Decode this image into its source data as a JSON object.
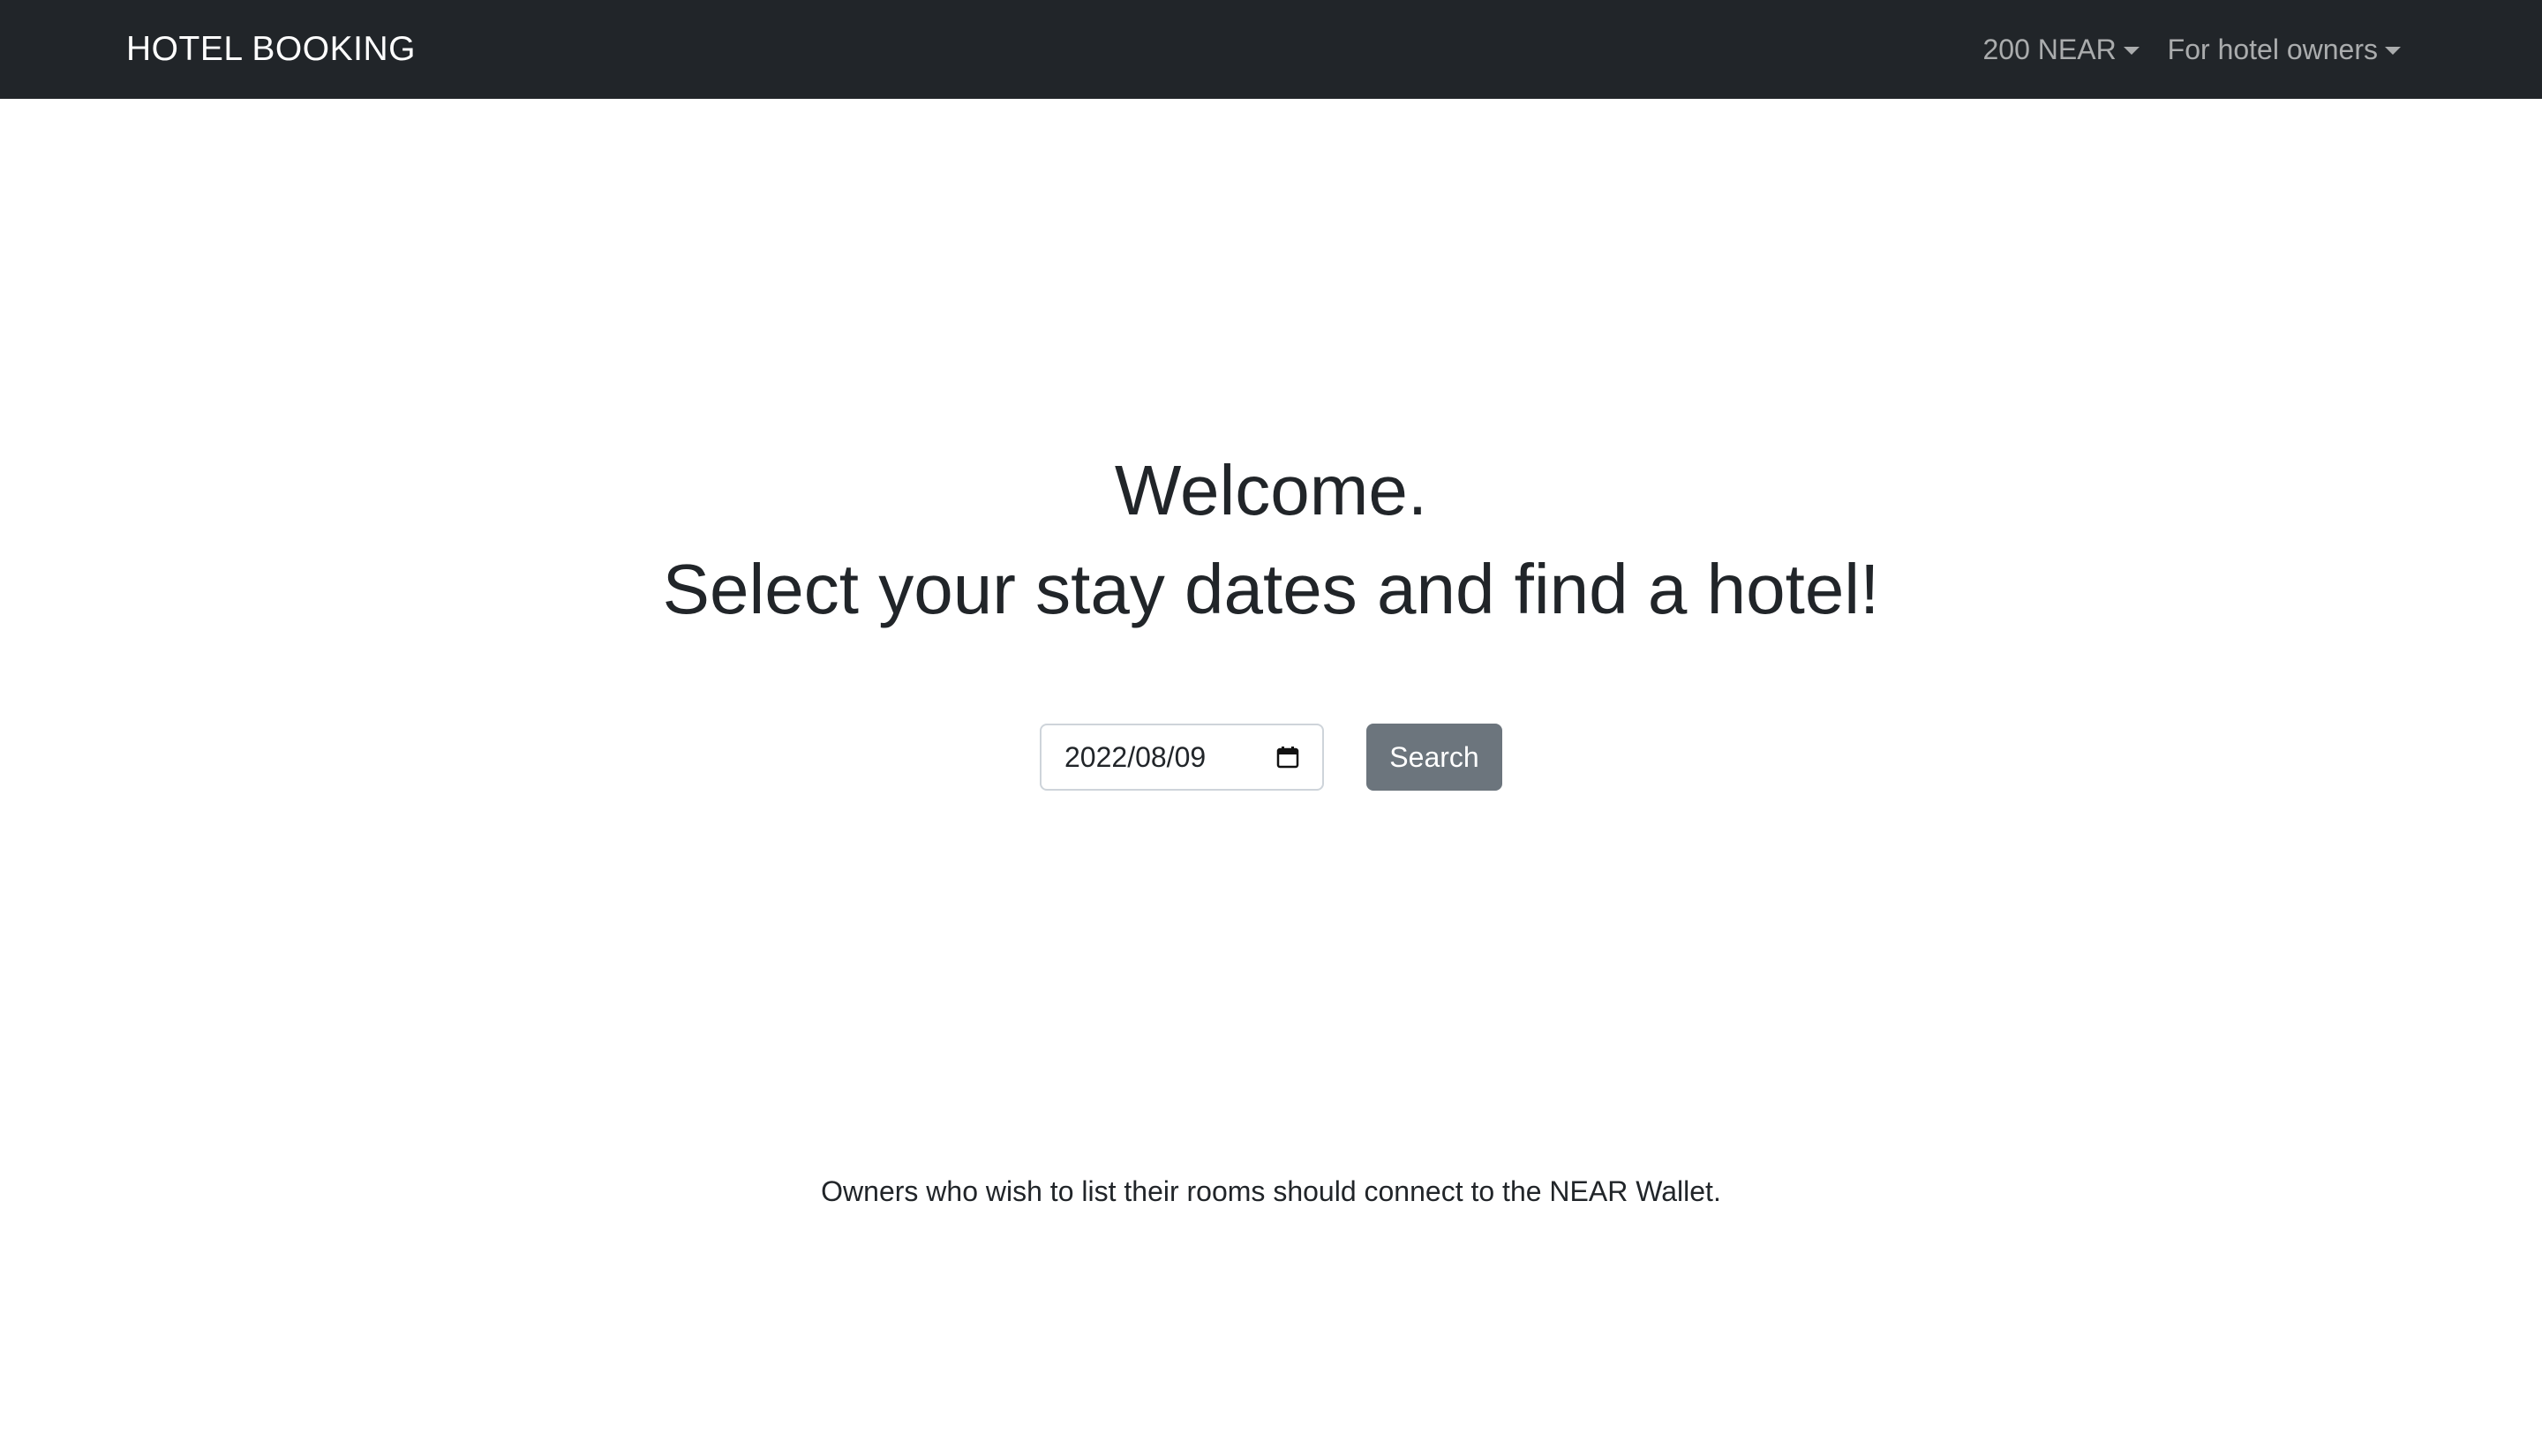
{
  "navbar": {
    "brand": "HOTEL BOOKING",
    "balance_dropdown": "200 NEAR",
    "owners_dropdown": "For hotel owners"
  },
  "hero": {
    "line1": "Welcome.",
    "line2": "Select your stay dates and find a hotel!"
  },
  "search": {
    "date_value": "2022/08/09",
    "button_label": "Search"
  },
  "footer_note": "Owners who wish to list their rooms should connect to the NEAR Wallet.",
  "colors": {
    "navbar_bg": "#212529",
    "search_button_bg": "#6c757d",
    "text": "#212529"
  },
  "icons": {
    "date_picker": "calendar-icon",
    "dropdown": "caret-down-icon"
  }
}
